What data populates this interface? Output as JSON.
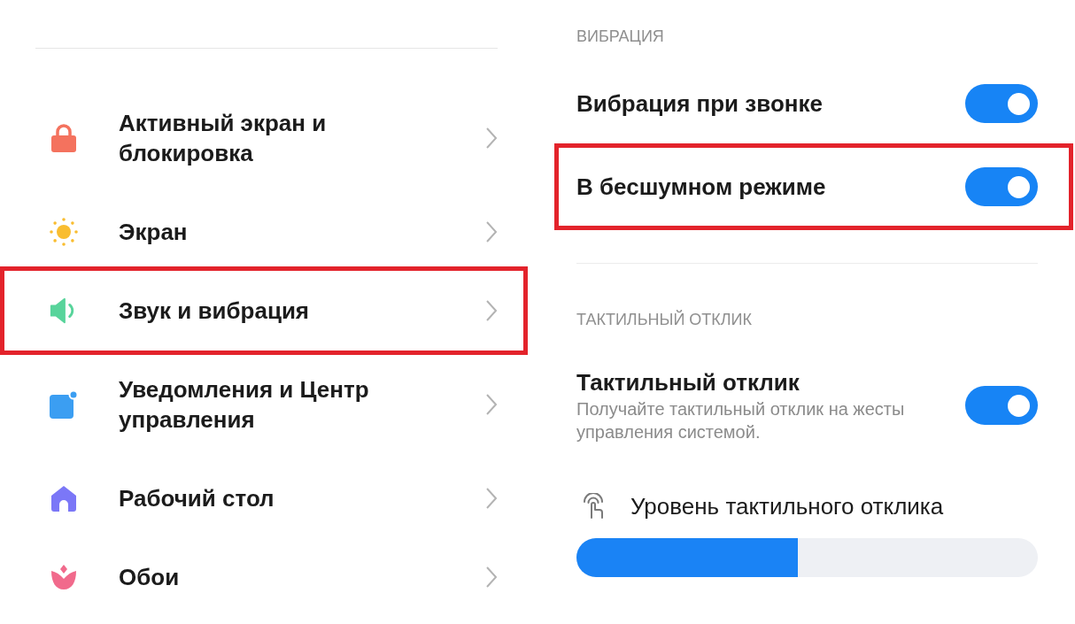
{
  "settings_list": {
    "items": [
      {
        "label": "Активный экран и блокировка",
        "highlighted": false
      },
      {
        "label": "Экран",
        "highlighted": false
      },
      {
        "label": "Звук и вибрация",
        "highlighted": true
      },
      {
        "label": "Уведомления и Центр управления",
        "highlighted": false
      },
      {
        "label": "Рабочий стол",
        "highlighted": false
      },
      {
        "label": "Обои",
        "highlighted": false
      }
    ]
  },
  "vibration_panel": {
    "sections": [
      {
        "header": "ВИБРАЦИЯ",
        "rows": [
          {
            "kind": "toggle",
            "title": "Вибрация при звонке",
            "on": true,
            "highlighted": false
          },
          {
            "kind": "toggle",
            "title": "В бесшумном режиме",
            "on": true,
            "highlighted": true
          }
        ]
      },
      {
        "header": "ТАКТИЛЬНЫЙ ОТКЛИК",
        "rows": [
          {
            "kind": "toggle",
            "title": "Тактильный отклик",
            "description": "Получайте тактильный отклик на жесты управления системой.",
            "on": true,
            "highlighted": false
          },
          {
            "kind": "slider",
            "title": "Уровень тактильного отклика",
            "level": 0.48
          }
        ]
      }
    ]
  }
}
